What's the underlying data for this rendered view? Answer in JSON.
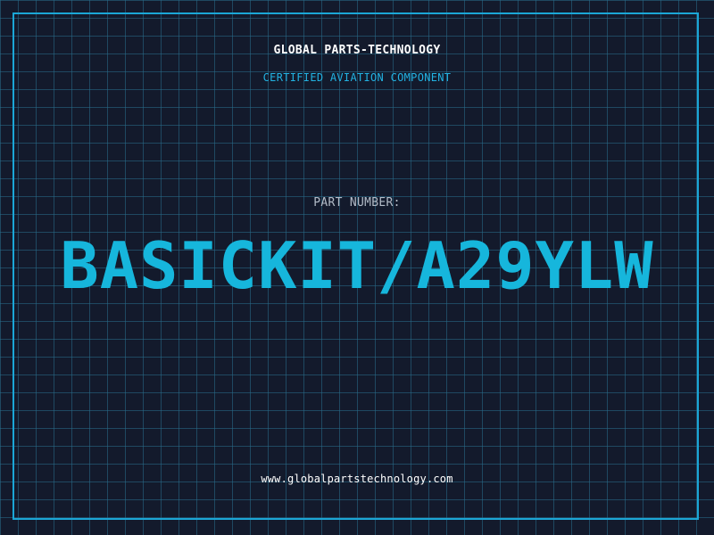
{
  "header": {
    "company": "GLOBAL PARTS-TECHNOLOGY",
    "tagline": "CERTIFIED AVIATION COMPONENT"
  },
  "part": {
    "label": "PART NUMBER:",
    "number": "BASICKIT/A29YLW"
  },
  "footer": {
    "website": "www.globalpartstechnology.com"
  },
  "colors": {
    "background": "#131a2c",
    "grid": "#286e8c",
    "accent": "#1ba6d6",
    "part_number": "#16b6dc"
  }
}
